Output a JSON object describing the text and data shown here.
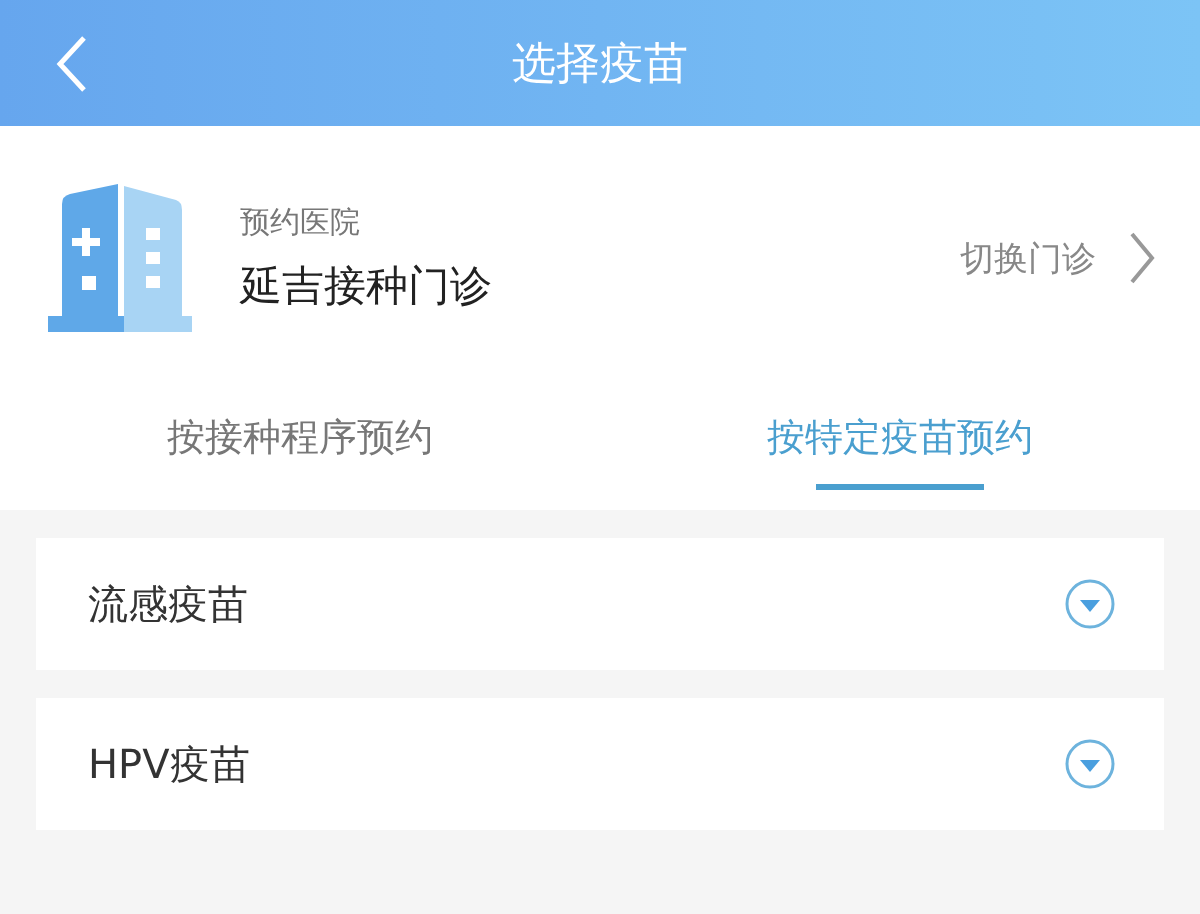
{
  "header": {
    "title": "选择疫苗"
  },
  "hospital": {
    "label": "预约医院",
    "name": "延吉接种门诊",
    "switch": "切换门诊"
  },
  "tabs": [
    {
      "label": "按接种程序预约",
      "selected": false
    },
    {
      "label": "按特定疫苗预约",
      "selected": true
    }
  ],
  "vaccines": [
    {
      "name": "流感疫苗",
      "expanded": false
    },
    {
      "name": "HPV疫苗",
      "expanded": false
    }
  ]
}
